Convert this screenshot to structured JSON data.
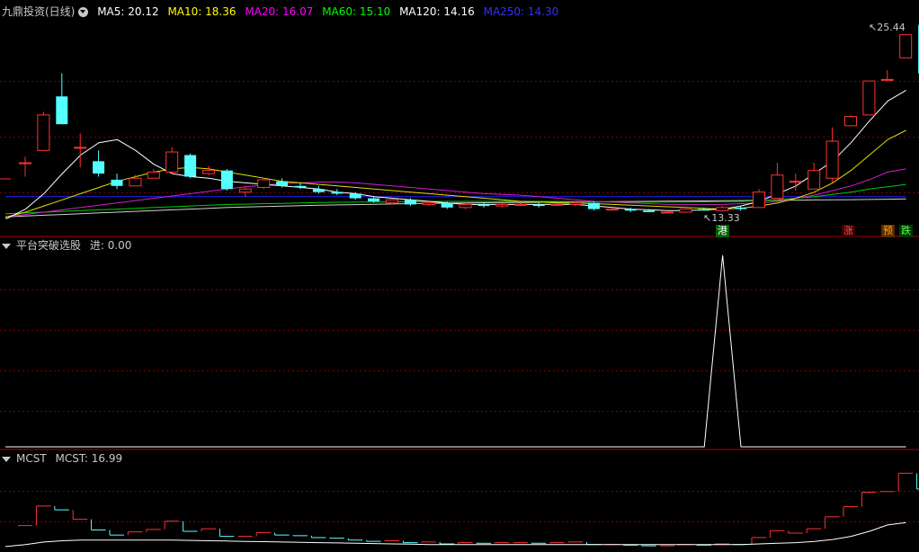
{
  "header": {
    "stock_name": "九鼎投资(日线)",
    "ma": [
      {
        "label": "MA5: 20.12",
        "color": "#ffffff"
      },
      {
        "label": "MA10: 18.36",
        "color": "#ffff00"
      },
      {
        "label": "MA20: 16.07",
        "color": "#ff00ff"
      },
      {
        "label": "MA60: 15.10",
        "color": "#00ff00"
      },
      {
        "label": "MA120: 14.16",
        "color": "#ffffff"
      },
      {
        "label": "MA250: 14.30",
        "color": "#0000ff"
      }
    ]
  },
  "panel2": {
    "name": "平台突破选股",
    "value_label": "进: 0.00"
  },
  "panel3": {
    "name": "MCST",
    "value_label": "MCST: 16.99"
  },
  "markers": {
    "high": "25.44",
    "low": "13.33",
    "tag_gang": "港",
    "tag_zhang": "涨",
    "tag_yu": "预",
    "tag_die": "跌"
  },
  "colors": {
    "up": "#ff3232",
    "down": "#54ffff",
    "grid": "#800000",
    "header_text": "#c8c8c8"
  },
  "chart_data": [
    {
      "type": "candlestick",
      "title": "九鼎投资(日线)",
      "high_label": 25.44,
      "low_label": 13.33,
      "ylim": [
        12.6,
        26.0
      ],
      "candles": [
        [
          16.5,
          16.5,
          16.9,
          15.6
        ],
        [
          17.3,
          19.6,
          19.8,
          17.3
        ],
        [
          20.8,
          19.0,
          22.3,
          19.0
        ],
        [
          17.5,
          17.5,
          18.4,
          16.2
        ],
        [
          16.6,
          15.8,
          17.3,
          15.6
        ],
        [
          15.4,
          15.0,
          15.8,
          14.8
        ],
        [
          15.0,
          15.5,
          15.7,
          15.0
        ],
        [
          15.5,
          15.9,
          16.1,
          15.5
        ],
        [
          15.9,
          17.2,
          17.5,
          15.8
        ],
        [
          17.0,
          15.6,
          17.1,
          15.5
        ],
        [
          15.8,
          16.0,
          16.3,
          15.7
        ],
        [
          16.0,
          14.8,
          16.1,
          14.7
        ],
        [
          14.6,
          14.8,
          15.0,
          14.3
        ],
        [
          14.9,
          15.4,
          15.5,
          14.8
        ],
        [
          15.3,
          15.0,
          15.5,
          14.9
        ],
        [
          15.0,
          14.9,
          15.2,
          14.8
        ],
        [
          14.8,
          14.6,
          15.0,
          14.5
        ],
        [
          14.6,
          14.5,
          14.8,
          14.4
        ],
        [
          14.5,
          14.2,
          14.6,
          14.1
        ],
        [
          14.2,
          14.0,
          14.3,
          13.9
        ],
        [
          13.9,
          14.1,
          14.2,
          13.8
        ],
        [
          14.1,
          13.8,
          14.2,
          13.7
        ],
        [
          13.8,
          13.9,
          14.0,
          13.7
        ],
        [
          13.9,
          13.6,
          14.0,
          13.5
        ],
        [
          13.6,
          13.8,
          13.9,
          13.5
        ],
        [
          13.8,
          13.7,
          13.9,
          13.6
        ],
        [
          13.7,
          13.8,
          13.9,
          13.6
        ],
        [
          13.8,
          13.8,
          13.9,
          13.7
        ],
        [
          13.8,
          13.7,
          13.9,
          13.6
        ],
        [
          13.8,
          13.8,
          13.9,
          13.7
        ],
        [
          13.8,
          13.9,
          14.0,
          13.7
        ],
        [
          13.9,
          13.5,
          14.0,
          13.4
        ],
        [
          13.5,
          13.5,
          13.6,
          13.4
        ],
        [
          13.5,
          13.4,
          13.6,
          13.3
        ],
        [
          13.4,
          13.3,
          13.5,
          13.3
        ],
        [
          13.3,
          13.3,
          13.4,
          13.3
        ],
        [
          13.3,
          13.5,
          13.5,
          13.3
        ],
        [
          13.5,
          13.4,
          13.6,
          13.4
        ],
        [
          13.4,
          13.6,
          13.7,
          13.33
        ],
        [
          13.6,
          13.5,
          13.7,
          13.4
        ],
        [
          13.6,
          14.6,
          14.8,
          13.6
        ],
        [
          14.2,
          15.7,
          16.5,
          14.2
        ],
        [
          15.3,
          15.3,
          15.8,
          14.7
        ],
        [
          14.8,
          16.0,
          16.5,
          14.8
        ],
        [
          15.5,
          17.9,
          18.8,
          15.2
        ],
        [
          18.9,
          19.5,
          19.6,
          18.9
        ],
        [
          19.6,
          21.8,
          21.8,
          19.6
        ],
        [
          21.9,
          21.9,
          22.5,
          21.9
        ],
        [
          23.3,
          24.8,
          24.8,
          23.3
        ],
        [
          25.44,
          22.3,
          25.44,
          22.3
        ]
      ],
      "ma5": [
        12.9,
        13.5,
        14.5,
        15.8,
        17.0,
        17.8,
        18.0,
        17.3,
        16.4,
        15.8,
        15.6,
        15.5,
        15.3,
        15.2,
        15.1,
        15.0,
        14.9,
        14.8,
        14.6,
        14.5,
        14.3,
        14.2,
        14.1,
        14.0,
        13.9,
        13.8,
        13.8,
        13.8,
        13.8,
        13.8,
        13.8,
        13.8,
        13.7,
        13.6,
        13.5,
        13.45,
        13.4,
        13.4,
        13.45,
        13.5,
        13.7,
        14.0,
        14.5,
        15.0,
        15.8,
        16.6,
        17.8,
        19.2,
        20.5,
        21.2
      ],
      "ma10": [
        13.0,
        13.3,
        13.7,
        14.1,
        14.5,
        14.9,
        15.3,
        15.6,
        15.9,
        16.1,
        16.2,
        16.1,
        15.9,
        15.7,
        15.5,
        15.3,
        15.2,
        15.1,
        15.0,
        14.9,
        14.8,
        14.7,
        14.6,
        14.5,
        14.4,
        14.3,
        14.2,
        14.1,
        14.0,
        13.95,
        13.9,
        13.9,
        13.85,
        13.8,
        13.75,
        13.7,
        13.65,
        13.6,
        13.55,
        13.5,
        13.55,
        13.7,
        13.9,
        14.2,
        14.6,
        15.2,
        16.0,
        17.0,
        18.0,
        18.6
      ],
      "ma20": [
        13.0,
        13.15,
        13.3,
        13.45,
        13.6,
        13.75,
        13.9,
        14.05,
        14.2,
        14.35,
        14.5,
        14.65,
        14.8,
        14.95,
        15.05,
        15.15,
        15.2,
        15.25,
        15.25,
        15.2,
        15.1,
        15.0,
        14.9,
        14.8,
        14.7,
        14.6,
        14.5,
        14.45,
        14.4,
        14.3,
        14.2,
        14.1,
        14.0,
        13.95,
        13.9,
        13.85,
        13.8,
        13.8,
        13.8,
        13.8,
        13.85,
        13.9,
        14.0,
        14.2,
        14.4,
        14.7,
        15.0,
        15.4,
        15.9,
        16.1
      ],
      "ma60": [
        13.2,
        13.25,
        13.3,
        13.35,
        13.4,
        13.45,
        13.5,
        13.55,
        13.6,
        13.65,
        13.7,
        13.75,
        13.8,
        13.82,
        13.85,
        13.87,
        13.9,
        13.92,
        13.94,
        13.95,
        13.96,
        13.97,
        13.98,
        13.99,
        14.0,
        14.0,
        14.0,
        14.0,
        14.0,
        14.0,
        13.99,
        13.98,
        13.97,
        13.96,
        13.95,
        13.95,
        13.95,
        13.96,
        13.97,
        13.98,
        14.0,
        14.05,
        14.1,
        14.2,
        14.3,
        14.45,
        14.6,
        14.8,
        14.95,
        15.1
      ],
      "ma120": [
        13.0,
        13.05,
        13.1,
        13.15,
        13.2,
        13.25,
        13.3,
        13.35,
        13.4,
        13.45,
        13.5,
        13.55,
        13.6,
        13.63,
        13.66,
        13.69,
        13.72,
        13.75,
        13.77,
        13.79,
        13.81,
        13.83,
        13.85,
        13.87,
        13.89,
        13.9,
        13.91,
        13.92,
        13.93,
        13.94,
        13.95,
        13.96,
        13.97,
        13.98,
        13.99,
        14.0,
        14.01,
        14.02,
        14.03,
        14.04,
        14.05,
        14.06,
        14.07,
        14.08,
        14.09,
        14.1,
        14.11,
        14.12,
        14.14,
        14.16
      ],
      "ma250": [
        14.3,
        14.3,
        14.3,
        14.3,
        14.3,
        14.3,
        14.3,
        14.3,
        14.3,
        14.3,
        14.3,
        14.3,
        14.3,
        14.3,
        14.3,
        14.3,
        14.3,
        14.3,
        14.3,
        14.3,
        14.3,
        14.3,
        14.3,
        14.3,
        14.3,
        14.3,
        14.3,
        14.3,
        14.3,
        14.3,
        14.3,
        14.3,
        14.3,
        14.3,
        14.3,
        14.3,
        14.3,
        14.3,
        14.3,
        14.3,
        14.3,
        14.3,
        14.3,
        14.3,
        14.3,
        14.3,
        14.3,
        14.3,
        14.3,
        14.3
      ]
    },
    {
      "type": "line",
      "title": "平台突破选股",
      "series": [
        {
          "name": "进",
          "values": [
            0,
            0,
            0,
            0,
            0,
            0,
            0,
            0,
            0,
            0,
            0,
            0,
            0,
            0,
            0,
            0,
            0,
            0,
            0,
            0,
            0,
            0,
            0,
            0,
            0,
            0,
            0,
            0,
            0,
            0,
            0,
            0,
            0,
            0,
            0,
            0,
            0,
            0,
            0,
            1,
            0,
            0,
            0,
            0,
            0,
            0,
            0,
            0,
            0,
            0
          ]
        }
      ],
      "ylim": [
        0,
        1
      ]
    },
    {
      "type": "line",
      "title": "MCST",
      "series": [
        {
          "name": "MCST",
          "values": [
            13.2,
            13.5,
            13.9,
            14.1,
            14.2,
            14.2,
            14.2,
            14.2,
            14.2,
            14.2,
            14.15,
            14.1,
            14.05,
            14.0,
            13.95,
            13.9,
            13.85,
            13.8,
            13.75,
            13.7,
            13.65,
            13.6,
            13.55,
            13.5,
            13.5,
            13.5,
            13.5,
            13.5,
            13.5,
            13.5,
            13.5,
            13.5,
            13.5,
            13.5,
            13.5,
            13.5,
            13.5,
            13.5,
            13.5,
            13.5,
            13.5,
            13.6,
            13.7,
            13.8,
            14.0,
            14.3,
            14.8,
            15.6,
            16.6,
            16.99
          ]
        }
      ]
    }
  ]
}
